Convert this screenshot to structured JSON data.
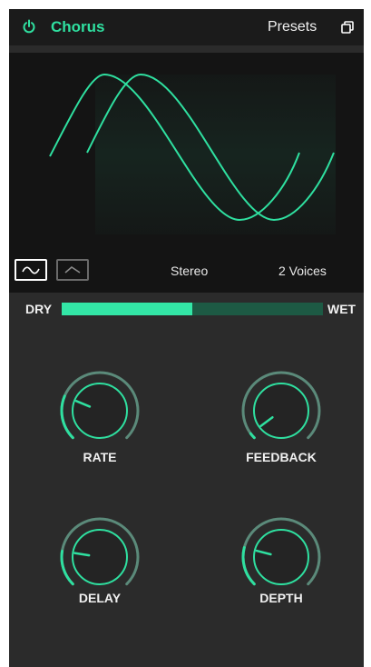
{
  "header": {
    "plugin_name": "Chorus",
    "presets_label": "Presets",
    "power_icon": "power-icon",
    "copy_icon": "copy-icon",
    "power_on": true
  },
  "display": {
    "waveforms": [
      "sine",
      "triangle"
    ],
    "selected_waveform": "sine",
    "mode_label": "Stereo",
    "voices_label": "2 Voices"
  },
  "mix": {
    "dry_label": "DRY",
    "wet_label": "WET",
    "value": 0.5
  },
  "knobs": [
    {
      "key": "rate",
      "label": "RATE",
      "value": 0.25
    },
    {
      "key": "feedback",
      "label": "FEEDBACK",
      "value": 0.03
    },
    {
      "key": "delay",
      "label": "DELAY",
      "value": 0.2
    },
    {
      "key": "depth",
      "label": "DEPTH",
      "value": 0.22
    }
  ],
  "colors": {
    "accent": "#2fe0a0",
    "panel": "#2b2b2b",
    "header_bg": "#1b1b1b",
    "display_bg": "#141414",
    "knob_track": "#5b8a7a",
    "mix_track": "#1d5a44"
  }
}
